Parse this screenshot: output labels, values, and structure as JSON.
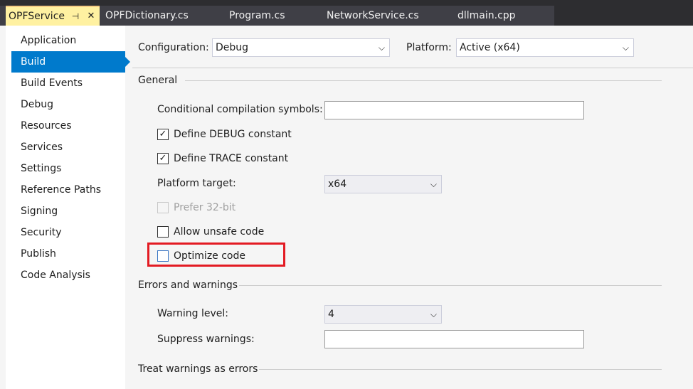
{
  "tabs": [
    {
      "label": "OPFService"
    },
    {
      "label": "OPFDictionary.cs"
    },
    {
      "label": "Program.cs"
    },
    {
      "label": "NetworkService.cs"
    },
    {
      "label": "dllmain.cpp"
    }
  ],
  "tab_icons": {
    "pin": "pin-icon",
    "close": "close-icon"
  },
  "sidebar": {
    "items": [
      {
        "label": "Application"
      },
      {
        "label": "Build"
      },
      {
        "label": "Build Events"
      },
      {
        "label": "Debug"
      },
      {
        "label": "Resources"
      },
      {
        "label": "Services"
      },
      {
        "label": "Settings"
      },
      {
        "label": "Reference Paths"
      },
      {
        "label": "Signing"
      },
      {
        "label": "Security"
      },
      {
        "label": "Publish"
      },
      {
        "label": "Code Analysis"
      }
    ],
    "selected": "Build"
  },
  "config": {
    "configuration_label": "Configuration:",
    "configuration_value": "Debug",
    "platform_label": "Platform:",
    "platform_value": "Active (x64)"
  },
  "general": {
    "heading": "General",
    "symbols_label": "Conditional compilation symbols:",
    "symbols_value": "",
    "define_debug": {
      "label": "Define DEBUG constant",
      "checked": true
    },
    "define_trace": {
      "label": "Define TRACE constant",
      "checked": true
    },
    "platform_target_label": "Platform target:",
    "platform_target_value": "x64",
    "prefer32": {
      "label": "Prefer 32-bit",
      "checked": false,
      "enabled": false
    },
    "unsafe": {
      "label": "Allow unsafe code",
      "checked": false
    },
    "optimize": {
      "label": "Optimize code",
      "checked": false
    }
  },
  "errors": {
    "heading": "Errors and warnings",
    "warning_level_label": "Warning level:",
    "warning_level_value": "4",
    "suppress_label": "Suppress warnings:",
    "suppress_value": ""
  },
  "treat_warnings": {
    "heading": "Treat warnings as errors"
  },
  "colors": {
    "accent": "#007acc",
    "highlight": "#e31b23",
    "active_tab": "#fff1a1"
  }
}
